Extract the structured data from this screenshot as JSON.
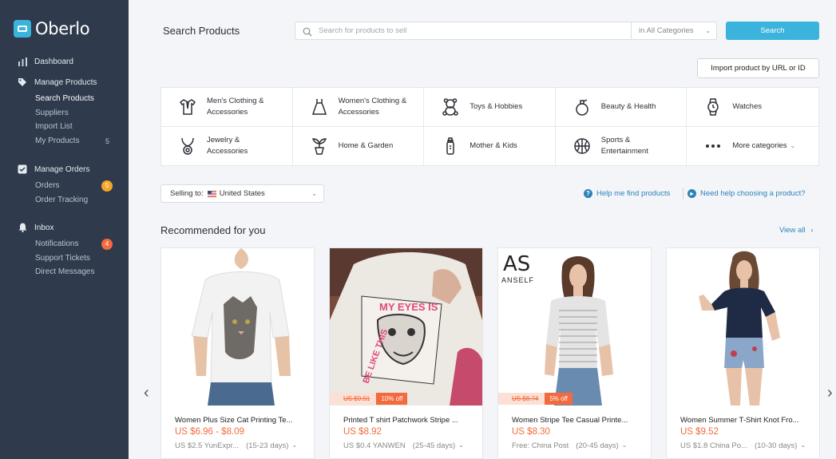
{
  "brand": {
    "name": "Oberlo"
  },
  "sidebar": {
    "dashboard": "Dashboard",
    "manage_products": "Manage Products",
    "products_items": [
      {
        "label": "Search Products",
        "count": ""
      },
      {
        "label": "Suppliers",
        "count": ""
      },
      {
        "label": "Import List",
        "count": ""
      },
      {
        "label": "My Products",
        "count": "5"
      }
    ],
    "manage_orders": "Manage Orders",
    "orders_items": [
      {
        "label": "Orders",
        "badge": "5"
      },
      {
        "label": "Order Tracking",
        "badge": ""
      }
    ],
    "inbox": "Inbox",
    "inbox_items": [
      {
        "label": "Notifications",
        "badge": "4"
      },
      {
        "label": "Support Tickets",
        "badge": ""
      },
      {
        "label": "Direct Messages",
        "badge": ""
      }
    ]
  },
  "header": {
    "title": "Search Products",
    "search_placeholder": "Search for products to sell",
    "category_select": "in All Categories",
    "search_button": "Search",
    "import_button": "Import product by URL or ID"
  },
  "categories": [
    {
      "label": "Men's Clothing & Accessories",
      "icon": "shirt-tie-icon"
    },
    {
      "label": "Women's Clothing & Accessories",
      "icon": "dress-icon"
    },
    {
      "label": "Toys & Hobbies",
      "icon": "teddy-bear-icon"
    },
    {
      "label": "Beauty & Health",
      "icon": "perfume-icon"
    },
    {
      "label": "Watches",
      "icon": "watch-icon"
    },
    {
      "label": "Jewelry & Accessories",
      "icon": "necklace-icon"
    },
    {
      "label": "Home & Garden",
      "icon": "plant-pot-icon"
    },
    {
      "label": "Mother & Kids",
      "icon": "baby-bottle-icon"
    },
    {
      "label": "Sports & Entertainment",
      "icon": "basketball-icon"
    },
    {
      "label": "More categories",
      "icon": "more-dots-icon"
    }
  ],
  "selling_to": {
    "label": "Selling to:",
    "country": "United States"
  },
  "help": {
    "find_products": "Help me find products",
    "choose_product": "Need help choosing a product?"
  },
  "recommended": {
    "title": "Recommended for you",
    "view_all": "View all",
    "products": [
      {
        "name": "Women Plus Size Cat Printing Te...",
        "price": "US $6.96 - $8.09",
        "shipping": "US $2.5 YunExpr...",
        "days": "(15-23 days)",
        "old_price": "",
        "discount": ""
      },
      {
        "name": "Printed T shirt Patchwork Stripe ...",
        "price": "US $8.92",
        "shipping": "US $0.4 YANWEN",
        "days": "(25-45 days)",
        "old_price": "US $9.91",
        "discount": "10% off"
      },
      {
        "name": "Women Stripe Tee Casual Printe...",
        "price": "US $8.30",
        "shipping": "Free: China Post",
        "days": "(20-45 days)",
        "old_price": "US $8.74",
        "discount": "5% off"
      },
      {
        "name": "Women Summer T-Shirt Knot Fro...",
        "price": "US $9.52",
        "shipping": "US $1.8 China Po...",
        "days": "(10-30 days)",
        "old_price": "",
        "discount": ""
      }
    ],
    "brand_logo_text": "ANSELF",
    "graphic_text": "MY EYES IS TOO ... BE LIKE THIS ... MY LIFE TO"
  },
  "colors": {
    "sidebar": "#2f3a4c",
    "accent": "#3ab4dc",
    "price": "#f26a3d",
    "link": "#2b82b8"
  }
}
